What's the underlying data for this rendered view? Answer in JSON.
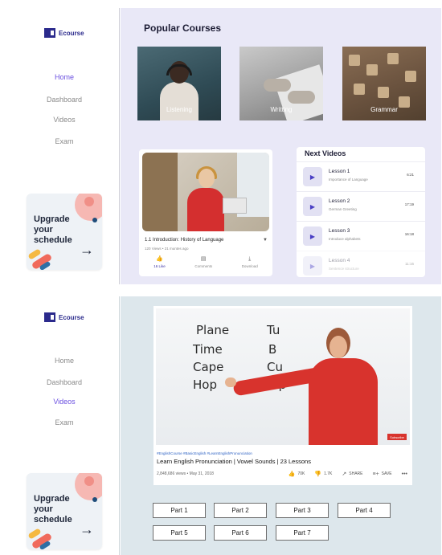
{
  "brand": {
    "logo_text": "Ecourse",
    "accent": "#6a4fe0",
    "brand_color": "#2b2a8c"
  },
  "screen1": {
    "nav": [
      "Home",
      "Dashboard",
      "Videos",
      "Exam"
    ],
    "active_nav": "Home",
    "promo_text": "Upgrade your schedule",
    "promo_arrow": "→",
    "section_title": "Popular Courses",
    "courses": [
      {
        "label": "Listening"
      },
      {
        "label": "Writting"
      },
      {
        "label": "Grammar"
      }
    ],
    "video": {
      "title": "1.1 Introduction: History of Language",
      "meta": "120 Views • 21 muntes ago",
      "actions": [
        {
          "label": "16 Like",
          "icon": "thumb-up-icon",
          "glyph": "👍"
        },
        {
          "label": "Comments",
          "icon": "comment-icon",
          "glyph": "▤"
        },
        {
          "label": "Download",
          "icon": "download-icon",
          "glyph": "⤓"
        }
      ]
    },
    "next_videos": {
      "title": "Next Videos",
      "lessons": [
        {
          "title": "Lesson 1",
          "subtitle": "Importance of Language",
          "time": "6:21"
        },
        {
          "title": "Lesson 2",
          "subtitle": "German Greeting",
          "time": "17:19"
        },
        {
          "title": "Lesson 3",
          "subtitle": "Introduce alphabets",
          "time": "16:18"
        },
        {
          "title": "Lesson 4",
          "subtitle": "Sentence structure",
          "time": "11:16"
        }
      ]
    }
  },
  "screen2": {
    "nav": [
      "Home",
      "Dashboard",
      "Videos",
      "Exam"
    ],
    "active_nav": "Videos",
    "promo_text": "Upgrade your schedule",
    "promo_arrow": "→",
    "board_words": [
      "Plane",
      "Time",
      "Cape",
      "Hop",
      "Tu",
      "B",
      "Cu",
      "Rip"
    ],
    "video": {
      "tags": "#EnglishCourse #BasicEnglish #LearnEnglishPronunciation",
      "title": "Learn English Pronunciation | Vowel Sounds | 23 Lessons",
      "meta": "2,848,686 views • May 31, 2018",
      "subscribe": "Subscribe",
      "actions": [
        {
          "label": "70K",
          "icon": "thumb-up-icon",
          "glyph": "👍"
        },
        {
          "label": "1.7K",
          "icon": "thumb-down-icon",
          "glyph": "👎"
        },
        {
          "label": "SHARE",
          "icon": "share-icon",
          "glyph": "↗"
        },
        {
          "label": "SAVE",
          "icon": "save-icon",
          "glyph": "≡+"
        },
        {
          "label": "",
          "icon": "more-icon",
          "glyph": "•••"
        }
      ]
    },
    "parts": [
      "Part 1",
      "Part 2",
      "Part 3",
      "Part 4",
      "Part 5",
      "Part 6",
      "Part 7"
    ]
  }
}
